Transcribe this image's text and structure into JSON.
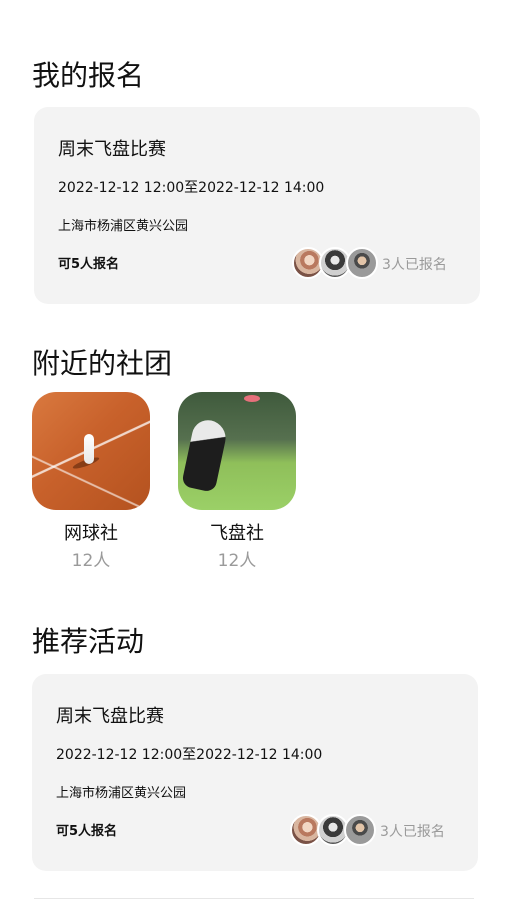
{
  "sections": {
    "my_signups": "我的报名",
    "nearby_clubs": "附近的社团",
    "recommended": "推荐活动"
  },
  "my_signup_card": {
    "title": "周末飞盘比赛",
    "time": "2022-12-12 12:00至2022-12-12 14:00",
    "place": "上海市杨浦区黄兴公园",
    "quota": "可5人报名",
    "signed_count": "3人已报名"
  },
  "clubs": [
    {
      "name": "网球社",
      "members": "12人",
      "image": "tennis-court-photo"
    },
    {
      "name": "飞盘社",
      "members": "12人",
      "image": "frisbee-dog-photo"
    }
  ],
  "recommended_card": {
    "title": "周末飞盘比赛",
    "time": "2022-12-12 12:00至2022-12-12 14:00",
    "place": "上海市杨浦区黄兴公园",
    "quota": "可5人报名",
    "signed_count": "3人已报名"
  },
  "colors": {
    "card_background": "#f3f3f3",
    "muted_text": "#9a9a9a",
    "primary_text": "#111111"
  }
}
